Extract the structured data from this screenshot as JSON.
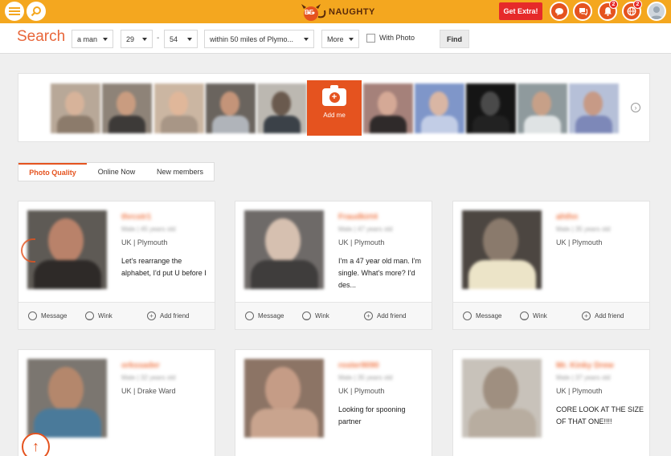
{
  "topbar": {
    "brand": "NAUGHTY",
    "brand_prefix": "BE",
    "get_extra_label": "Get Extra!",
    "notifications_count": "2",
    "dating_count": "2",
    "colors": {
      "bar": "#f4a71f",
      "accent": "#e5531f",
      "badge": "#e62a2a"
    }
  },
  "search": {
    "title": "Search",
    "gender": "a man",
    "age_from": "29",
    "age_sep": "-",
    "age_to": "54",
    "distance": "within 50 miles of Plymo...",
    "more": "More",
    "with_photo_label": "With Photo",
    "find_label": "Find"
  },
  "strip": {
    "add_me_label": "Add me"
  },
  "tabs": [
    {
      "label": "Photo Quality",
      "active": true
    },
    {
      "label": "Online Now",
      "active": false
    },
    {
      "label": "New members",
      "active": false
    }
  ],
  "actions": {
    "message": "Message",
    "wink": "Wink",
    "add_friend": "Add friend"
  },
  "cards": [
    {
      "username": "thrcstr1",
      "meta": "Male | 45 years old",
      "location": "UK | Plymouth",
      "bio": "Let's rearrange the alphabet, I'd put U before I"
    },
    {
      "username": "Fraudkirt4",
      "meta": "Male | 47 years old",
      "location": "UK | Plymouth",
      "bio": "I'm a 47 year old man. I'm single. What's more? I'd des..."
    },
    {
      "username": "ahthn",
      "meta": "Male | 35 years old",
      "location": "UK | Plymouth",
      "bio": ""
    },
    {
      "username": "orkssader",
      "meta": "Male | 32 years old",
      "location": "UK | Drake Ward",
      "bio": ""
    },
    {
      "username": "roster9090",
      "meta": "Male | 35 years old",
      "location": "UK | Plymouth",
      "bio": "Looking for spooning partner"
    },
    {
      "username": "Mr. Kinky Drew",
      "meta": "Male | 37 years old",
      "location": "UK | Plymouth",
      "bio": "CORE LOOK AT THE SIZE OF THAT ONE!!!!"
    }
  ]
}
